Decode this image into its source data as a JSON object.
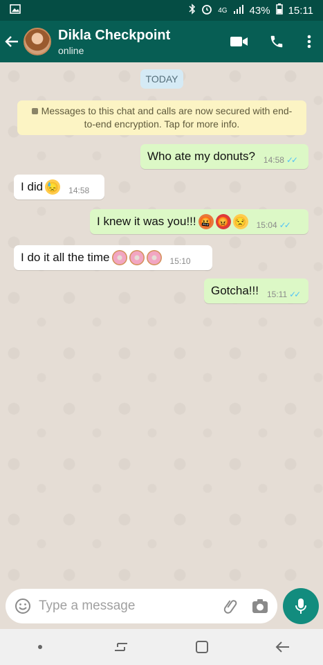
{
  "status_bar": {
    "network": "4G",
    "battery": "43%",
    "time": "15:11"
  },
  "header": {
    "contact_name": "Dikla Checkpoint",
    "contact_status": "online"
  },
  "chat": {
    "date_chip": "TODAY",
    "encryption_notice": "Messages to this chat and calls are now secured with end-to-end encryption. Tap for more info.",
    "messages": [
      {
        "direction": "out",
        "text": "Who ate my donuts?",
        "time": "14:58",
        "read": true
      },
      {
        "direction": "in",
        "text": "I did",
        "emojis": [
          "sad-face"
        ],
        "time": "14:58"
      },
      {
        "direction": "out",
        "text": "I knew it was you!!!",
        "emojis": [
          "cursing-face",
          "angry-face",
          "annoyed-face"
        ],
        "time": "15:04",
        "read": true
      },
      {
        "direction": "in",
        "text": "I do it all the time",
        "emojis": [
          "donut",
          "donut",
          "donut"
        ],
        "time": "15:10"
      },
      {
        "direction": "out",
        "text": "Gotcha!!!",
        "time": "15:11",
        "read": true
      }
    ]
  },
  "composer": {
    "placeholder": "Type a message"
  },
  "colors": {
    "header": "#075e54",
    "status_bar": "#054d44",
    "outgoing_bubble": "#dcf8c6",
    "incoming_bubble": "#ffffff",
    "accent": "#128c7e",
    "read_ticks": "#4fc3f7"
  }
}
